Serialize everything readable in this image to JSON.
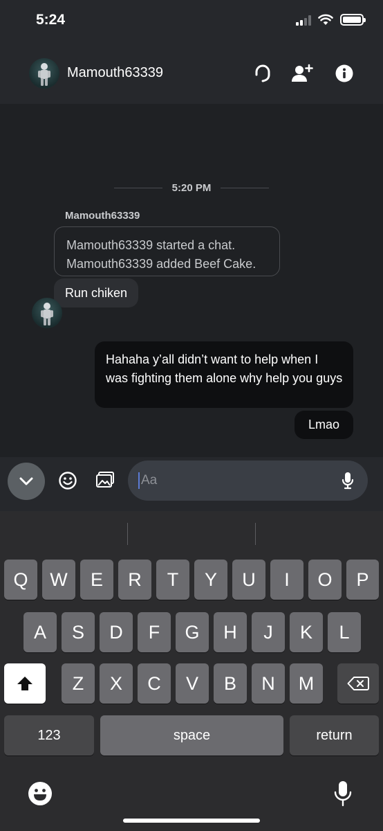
{
  "status_bar": {
    "time": "5:24"
  },
  "header": {
    "username": "Mamouth63339"
  },
  "messages": {
    "time_divider": "5:20 PM",
    "sender": "Mamouth63339",
    "system_lines": [
      "Mamouth63339 started a chat.",
      "Mamouth63339 added Beef Cake."
    ],
    "incoming": "Run chiken",
    "outgoing": [
      "Hahaha y’all didn’t want to help when I was fighting them alone why help you guys",
      "Lmao"
    ]
  },
  "input": {
    "placeholder": "Aa"
  },
  "keyboard": {
    "row1": [
      "Q",
      "W",
      "E",
      "R",
      "T",
      "Y",
      "U",
      "I",
      "O",
      "P"
    ],
    "row2": [
      "A",
      "S",
      "D",
      "F",
      "G",
      "H",
      "J",
      "K",
      "L"
    ],
    "row3": [
      "Z",
      "X",
      "C",
      "V",
      "B",
      "N",
      "M"
    ],
    "numbers_label": "123",
    "space_label": "space",
    "return_label": "return"
  },
  "icons": {
    "header": [
      "headset-icon",
      "add-friend-icon",
      "info-icon"
    ],
    "input_bar": [
      "chevron-down-icon",
      "emoji-icon",
      "image-icon",
      "microphone-icon"
    ],
    "keyboard": [
      "shift-icon",
      "backspace-icon",
      "emoji-icon",
      "microphone-icon"
    ]
  },
  "colors": {
    "background": "#1f2124",
    "header_background": "#26282c",
    "outgoing_bubble": "#0e0f11",
    "incoming_bubble": "#2d2f33",
    "caret": "#5b7bd5"
  }
}
